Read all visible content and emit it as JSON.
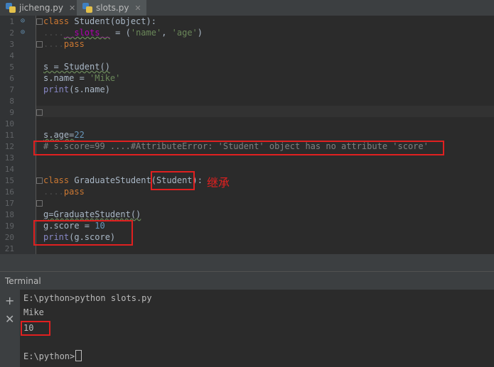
{
  "tabs": [
    {
      "label": "jicheng.py",
      "active": false
    },
    {
      "label": "slots.py",
      "active": true
    }
  ],
  "line_numbers": [
    "1",
    "2",
    "3",
    "4",
    "5",
    "6",
    "7",
    "8",
    "9",
    "10",
    "11",
    "12",
    "13",
    "14",
    "15",
    "16",
    "17",
    "18",
    "19",
    "20",
    "21"
  ],
  "code": {
    "l1": {
      "kw": "class",
      "rest": " Student(object):"
    },
    "l2": {
      "dots": "....",
      "attr": "__slots__",
      "eq": " = (",
      "s1": "'name'",
      "comma": ", ",
      "s2": "'age'",
      "close": ")"
    },
    "l3": {
      "dots": "....",
      "kw": "pass"
    },
    "l5": "s = Student()",
    "l6": {
      "pre": "s.name = ",
      "str": "'Mike'"
    },
    "l7": {
      "fn": "print",
      "rest": "(s.name)"
    },
    "l11": {
      "pre": "s.age=",
      "num": "22"
    },
    "l12": "# s.score=99 ....#AttributeError: 'Student' object has no attribute 'score'",
    "l15": {
      "kw": "class",
      "pre": " GraduateStudent(",
      "base": "Student",
      "post": "):"
    },
    "l16": {
      "dots": "....",
      "kw": "pass"
    },
    "l18": "g=GraduateStudent()",
    "l19": {
      "pre": "g.score = ",
      "num": "10"
    },
    "l20": {
      "fn": "print",
      "rest": "(g.score)"
    }
  },
  "annotation_note": "继承",
  "terminal": {
    "title": "Terminal",
    "add_icon": "+",
    "close_icon": "✕",
    "lines": [
      "E:\\python>python slots.py",
      "Mike",
      "10",
      "",
      "E:\\python>"
    ]
  },
  "colors": {
    "background": "#2b2b2b",
    "keyword": "#cc7832",
    "string": "#6a8759",
    "number": "#6897bb",
    "comment": "#808080",
    "highlight_box": "#e02020"
  }
}
